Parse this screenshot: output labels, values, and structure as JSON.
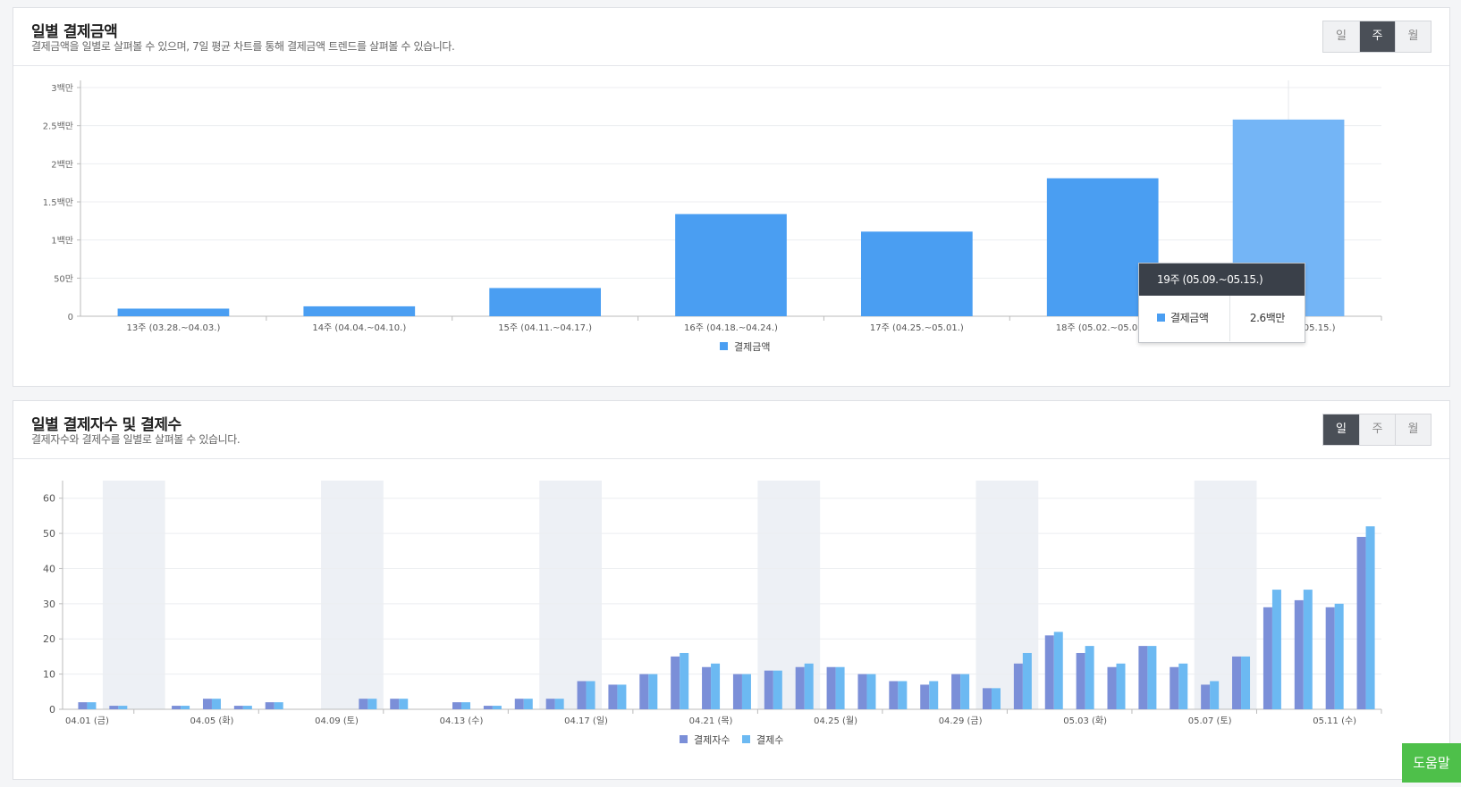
{
  "panel1": {
    "title": "일별 결제금액",
    "subtitle": "결제금액을 일별로 살펴볼 수 있으며, 7일 평균 차트를 통해 결제금액 트렌드를 살펴볼 수 있습니다.",
    "toggle": [
      "일",
      "주",
      "월"
    ],
    "active": 1
  },
  "panel2": {
    "title": "일별 결제자수 및 결제수",
    "subtitle": "결제자수와 결제수를 일별로 살펴볼 수 있습니다.",
    "toggle": [
      "일",
      "주",
      "월"
    ],
    "active": 0
  },
  "tooltip": {
    "title": "19주 (05.09.~05.15.)",
    "series": "결제금액",
    "value": "2.6백만"
  },
  "help_label": "도움말",
  "colors": {
    "amount": "#4a9ef2",
    "amount_hover": "#74b5f6",
    "payers": "#7b8fd8",
    "payments": "#6cb9f2",
    "weekend": "#edf0f5"
  },
  "chart_data": [
    {
      "type": "bar",
      "categories": [
        "13주 (03.28.~04.03.)",
        "14주 (04.04.~04.10.)",
        "15주 (04.11.~04.17.)",
        "16주 (04.18.~04.24.)",
        "17주 (04.25.~05.01.)",
        "18주 (05.02.~05.08.)",
        "19주 (05.09.~05.15.)"
      ],
      "series": [
        {
          "name": "결제금액",
          "values": [
            100000,
            130000,
            370000,
            1340000,
            1110000,
            1810000,
            2580000
          ]
        }
      ],
      "ylim": [
        0,
        3000000
      ],
      "yticks": [
        0,
        500000,
        1000000,
        1500000,
        2000000,
        2500000,
        3000000
      ],
      "ytick_labels": [
        "0",
        "50만",
        "1백만",
        "1.5백만",
        "2백만",
        "2.5백만",
        "3백만"
      ],
      "legend": "bottom-center",
      "grid": true
    },
    {
      "type": "bar",
      "x": [
        "04.01",
        "04.02",
        "04.03",
        "04.04",
        "04.05",
        "04.06",
        "04.07",
        "04.08",
        "04.09",
        "04.10",
        "04.11",
        "04.12",
        "04.13",
        "04.14",
        "04.15",
        "04.16",
        "04.17",
        "04.18",
        "04.19",
        "04.20",
        "04.21",
        "04.22",
        "04.23",
        "04.24",
        "04.25",
        "04.26",
        "04.27",
        "04.28",
        "04.29",
        "04.30",
        "05.01",
        "05.02",
        "05.03",
        "05.04",
        "05.05",
        "05.06",
        "05.07",
        "05.08",
        "05.09",
        "05.10",
        "05.11",
        "05.12"
      ],
      "xtick_labels": [
        "04.01 (금)",
        "04.05 (화)",
        "04.09 (토)",
        "04.13 (수)",
        "04.17 (일)",
        "04.21 (목)",
        "04.25 (월)",
        "04.29 (금)",
        "05.03 (화)",
        "05.07 (토)",
        "05.11 (수)"
      ],
      "series": [
        {
          "name": "결제자수",
          "values": [
            2,
            1,
            0,
            1,
            3,
            1,
            2,
            0,
            0,
            3,
            3,
            0,
            2,
            1,
            3,
            3,
            8,
            7,
            10,
            15,
            12,
            10,
            11,
            12,
            12,
            10,
            8,
            7,
            10,
            6,
            13,
            21,
            16,
            12,
            18,
            12,
            7,
            15,
            29,
            31,
            29,
            49
          ]
        },
        {
          "name": "결제수",
          "values": [
            2,
            1,
            0,
            1,
            3,
            1,
            2,
            0,
            0,
            3,
            3,
            0,
            2,
            1,
            3,
            3,
            8,
            7,
            10,
            16,
            13,
            10,
            11,
            13,
            12,
            10,
            8,
            8,
            10,
            6,
            16,
            22,
            18,
            13,
            18,
            13,
            8,
            15,
            34,
            34,
            30,
            52
          ]
        }
      ],
      "weekend_bands": [
        [
          "04.02",
          "04.03"
        ],
        [
          "04.09",
          "04.10"
        ],
        [
          "04.16",
          "04.17"
        ],
        [
          "04.23",
          "04.24"
        ],
        [
          "04.30",
          "05.01"
        ],
        [
          "05.07",
          "05.08"
        ]
      ],
      "ylim": [
        0,
        65
      ],
      "yticks": [
        0,
        10,
        20,
        30,
        40,
        50,
        60
      ],
      "legend": "bottom-center",
      "grid": true
    }
  ]
}
